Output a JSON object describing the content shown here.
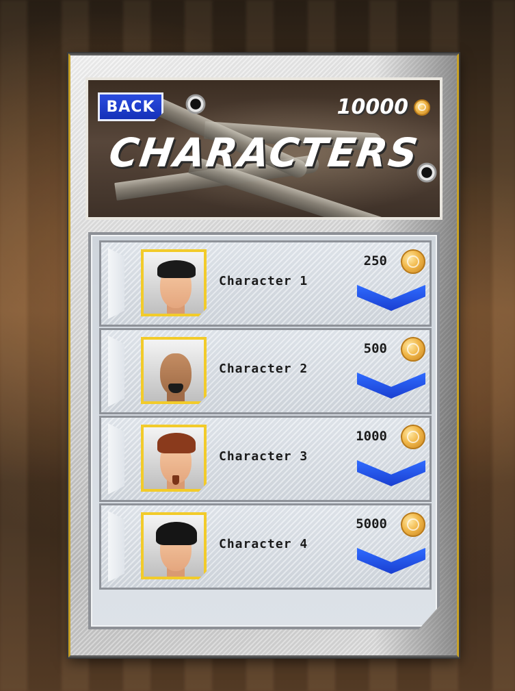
{
  "header": {
    "back_label": "BACK",
    "coins": "10000",
    "title": "CHARACTERS"
  },
  "characters": [
    {
      "name": "Character 1",
      "price": "250",
      "hair_color": "#1a1a1a",
      "skin": "#f4c6a0"
    },
    {
      "name": "Character 2",
      "price": "500",
      "hair_color": "none",
      "skin": "#b9835c"
    },
    {
      "name": "Character 3",
      "price": "1000",
      "hair_color": "#8a3a1c",
      "skin": "#f0c09a"
    },
    {
      "name": "Character 4",
      "price": "5000",
      "hair_color": "#151515",
      "skin": "#f4c6a0"
    }
  ],
  "colors": {
    "accent_blue": "#1f44d8",
    "avatar_border": "#f2cb2a",
    "coin_gold": "#f1b84a"
  },
  "icons": {
    "currency": "gold-coin-icon",
    "select": "chevron-down-icon",
    "decoration": "bullet-hole-icon"
  }
}
